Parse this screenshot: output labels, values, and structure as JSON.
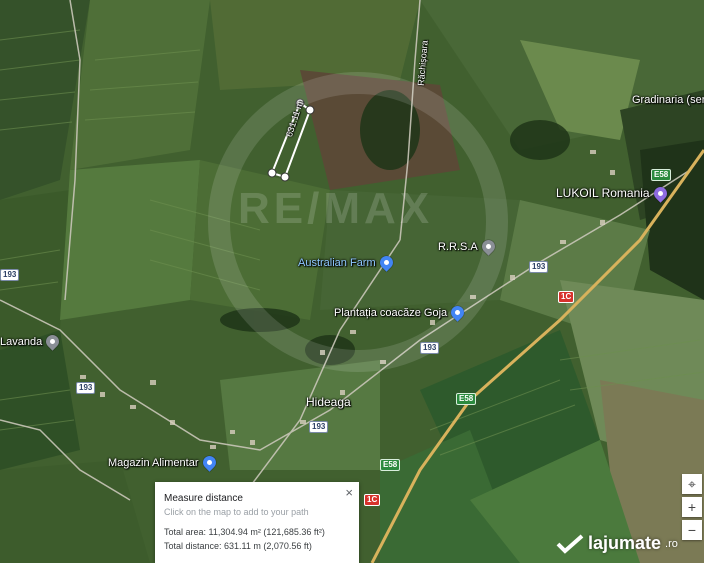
{
  "map": {
    "labels": {
      "road_rachitisoara": "Răchișoara",
      "gradinaria": "Gradinaria (sere)",
      "lukoil": "LUKOIL Romania",
      "rrsa": "R.R.S.A",
      "australian_farm": "Australian Farm",
      "plantatia": "Plantația coacăze Goja",
      "lavanda": "Lavanda",
      "hideaga": "Hideaga",
      "magazin": "Magazin Alimentar"
    },
    "shields": {
      "r193_a": "193",
      "r193_b": "193",
      "r193_c": "193",
      "r193_d": "193",
      "r193_e": "193",
      "r1c_a": "1C",
      "r1c_b": "1C",
      "e58_a": "E58",
      "e58_b": "E58",
      "e58_c": "E58"
    },
    "measure_line_label": "631.11 m",
    "watermark": "RE/MAX"
  },
  "measure_panel": {
    "title": "Measure distance",
    "hint": "Click on the map to add to your path",
    "total_area": "Total area: 11,304.94 m² (121,685.36 ft²)",
    "total_distance": "Total distance: 631.11 m (2,070.56 ft)",
    "close": "×"
  },
  "controls": {
    "locate": "⌖",
    "zoom_in": "+",
    "zoom_out": "−"
  },
  "brand": {
    "name": "lajumate",
    "tld": ".ro"
  },
  "colors": {
    "field_dark": "#2f4a24",
    "field_light": "#5f7d40",
    "road_main": "#d8b25c",
    "measure_line": "#ffffff"
  }
}
